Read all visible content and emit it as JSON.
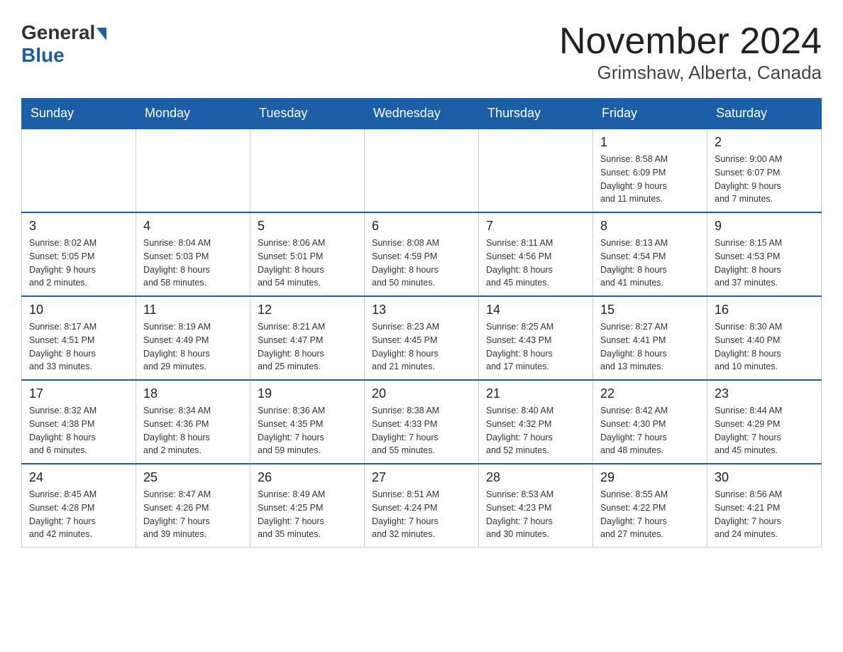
{
  "header": {
    "logo_general": "General",
    "logo_blue": "Blue",
    "month_year": "November 2024",
    "location": "Grimshaw, Alberta, Canada"
  },
  "weekdays": [
    "Sunday",
    "Monday",
    "Tuesday",
    "Wednesday",
    "Thursday",
    "Friday",
    "Saturday"
  ],
  "weeks": [
    [
      {
        "day": "",
        "info": ""
      },
      {
        "day": "",
        "info": ""
      },
      {
        "day": "",
        "info": ""
      },
      {
        "day": "",
        "info": ""
      },
      {
        "day": "",
        "info": ""
      },
      {
        "day": "1",
        "info": "Sunrise: 8:58 AM\nSunset: 6:09 PM\nDaylight: 9 hours\nand 11 minutes."
      },
      {
        "day": "2",
        "info": "Sunrise: 9:00 AM\nSunset: 6:07 PM\nDaylight: 9 hours\nand 7 minutes."
      }
    ],
    [
      {
        "day": "3",
        "info": "Sunrise: 8:02 AM\nSunset: 5:05 PM\nDaylight: 9 hours\nand 2 minutes."
      },
      {
        "day": "4",
        "info": "Sunrise: 8:04 AM\nSunset: 5:03 PM\nDaylight: 8 hours\nand 58 minutes."
      },
      {
        "day": "5",
        "info": "Sunrise: 8:06 AM\nSunset: 5:01 PM\nDaylight: 8 hours\nand 54 minutes."
      },
      {
        "day": "6",
        "info": "Sunrise: 8:08 AM\nSunset: 4:59 PM\nDaylight: 8 hours\nand 50 minutes."
      },
      {
        "day": "7",
        "info": "Sunrise: 8:11 AM\nSunset: 4:56 PM\nDaylight: 8 hours\nand 45 minutes."
      },
      {
        "day": "8",
        "info": "Sunrise: 8:13 AM\nSunset: 4:54 PM\nDaylight: 8 hours\nand 41 minutes."
      },
      {
        "day": "9",
        "info": "Sunrise: 8:15 AM\nSunset: 4:53 PM\nDaylight: 8 hours\nand 37 minutes."
      }
    ],
    [
      {
        "day": "10",
        "info": "Sunrise: 8:17 AM\nSunset: 4:51 PM\nDaylight: 8 hours\nand 33 minutes."
      },
      {
        "day": "11",
        "info": "Sunrise: 8:19 AM\nSunset: 4:49 PM\nDaylight: 8 hours\nand 29 minutes."
      },
      {
        "day": "12",
        "info": "Sunrise: 8:21 AM\nSunset: 4:47 PM\nDaylight: 8 hours\nand 25 minutes."
      },
      {
        "day": "13",
        "info": "Sunrise: 8:23 AM\nSunset: 4:45 PM\nDaylight: 8 hours\nand 21 minutes."
      },
      {
        "day": "14",
        "info": "Sunrise: 8:25 AM\nSunset: 4:43 PM\nDaylight: 8 hours\nand 17 minutes."
      },
      {
        "day": "15",
        "info": "Sunrise: 8:27 AM\nSunset: 4:41 PM\nDaylight: 8 hours\nand 13 minutes."
      },
      {
        "day": "16",
        "info": "Sunrise: 8:30 AM\nSunset: 4:40 PM\nDaylight: 8 hours\nand 10 minutes."
      }
    ],
    [
      {
        "day": "17",
        "info": "Sunrise: 8:32 AM\nSunset: 4:38 PM\nDaylight: 8 hours\nand 6 minutes."
      },
      {
        "day": "18",
        "info": "Sunrise: 8:34 AM\nSunset: 4:36 PM\nDaylight: 8 hours\nand 2 minutes."
      },
      {
        "day": "19",
        "info": "Sunrise: 8:36 AM\nSunset: 4:35 PM\nDaylight: 7 hours\nand 59 minutes."
      },
      {
        "day": "20",
        "info": "Sunrise: 8:38 AM\nSunset: 4:33 PM\nDaylight: 7 hours\nand 55 minutes."
      },
      {
        "day": "21",
        "info": "Sunrise: 8:40 AM\nSunset: 4:32 PM\nDaylight: 7 hours\nand 52 minutes."
      },
      {
        "day": "22",
        "info": "Sunrise: 8:42 AM\nSunset: 4:30 PM\nDaylight: 7 hours\nand 48 minutes."
      },
      {
        "day": "23",
        "info": "Sunrise: 8:44 AM\nSunset: 4:29 PM\nDaylight: 7 hours\nand 45 minutes."
      }
    ],
    [
      {
        "day": "24",
        "info": "Sunrise: 8:45 AM\nSunset: 4:28 PM\nDaylight: 7 hours\nand 42 minutes."
      },
      {
        "day": "25",
        "info": "Sunrise: 8:47 AM\nSunset: 4:26 PM\nDaylight: 7 hours\nand 39 minutes."
      },
      {
        "day": "26",
        "info": "Sunrise: 8:49 AM\nSunset: 4:25 PM\nDaylight: 7 hours\nand 35 minutes."
      },
      {
        "day": "27",
        "info": "Sunrise: 8:51 AM\nSunset: 4:24 PM\nDaylight: 7 hours\nand 32 minutes."
      },
      {
        "day": "28",
        "info": "Sunrise: 8:53 AM\nSunset: 4:23 PM\nDaylight: 7 hours\nand 30 minutes."
      },
      {
        "day": "29",
        "info": "Sunrise: 8:55 AM\nSunset: 4:22 PM\nDaylight: 7 hours\nand 27 minutes."
      },
      {
        "day": "30",
        "info": "Sunrise: 8:56 AM\nSunset: 4:21 PM\nDaylight: 7 hours\nand 24 minutes."
      }
    ]
  ]
}
